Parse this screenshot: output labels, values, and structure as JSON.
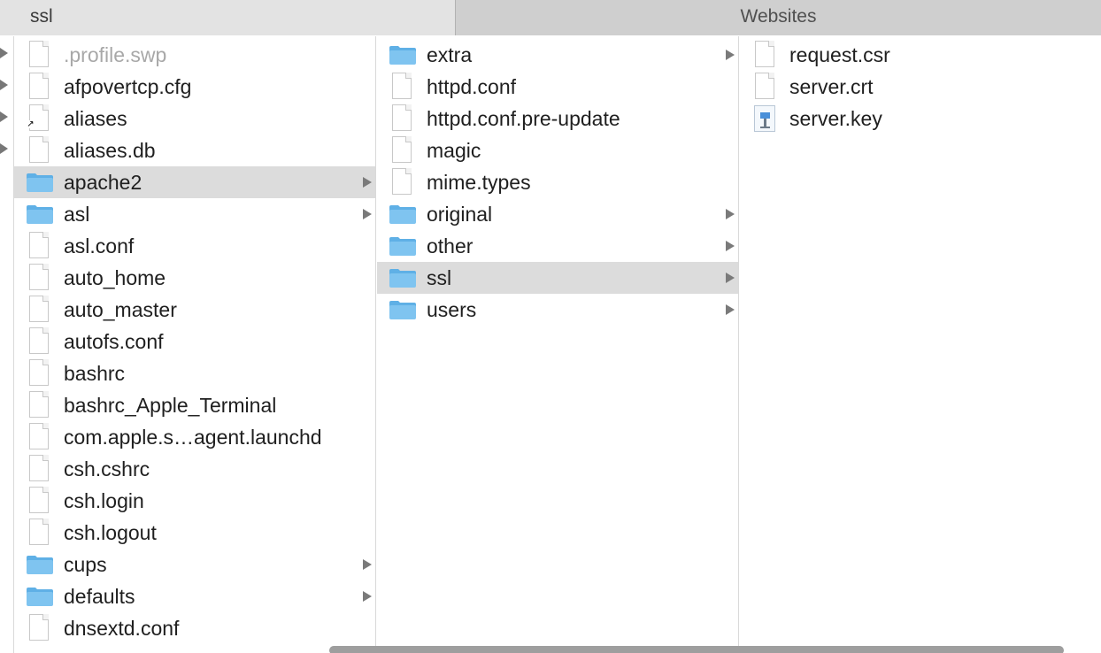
{
  "tabs": [
    {
      "label": "ssl",
      "active": true
    },
    {
      "label": "Websites",
      "active": false
    }
  ],
  "columns": [
    {
      "items": [
        {
          "name": ".profile.swp",
          "kind": "file",
          "dim": true
        },
        {
          "name": "afpovertcp.cfg",
          "kind": "file"
        },
        {
          "name": "aliases",
          "kind": "alias"
        },
        {
          "name": "aliases.db",
          "kind": "file"
        },
        {
          "name": "apache2",
          "kind": "folder",
          "selected": true
        },
        {
          "name": "asl",
          "kind": "folder"
        },
        {
          "name": "asl.conf",
          "kind": "file"
        },
        {
          "name": "auto_home",
          "kind": "file"
        },
        {
          "name": "auto_master",
          "kind": "file"
        },
        {
          "name": "autofs.conf",
          "kind": "file"
        },
        {
          "name": "bashrc",
          "kind": "file"
        },
        {
          "name": "bashrc_Apple_Terminal",
          "kind": "file"
        },
        {
          "name": "com.apple.s…agent.launchd",
          "kind": "file"
        },
        {
          "name": "csh.cshrc",
          "kind": "file"
        },
        {
          "name": "csh.login",
          "kind": "file"
        },
        {
          "name": "csh.logout",
          "kind": "file"
        },
        {
          "name": "cups",
          "kind": "folder"
        },
        {
          "name": "defaults",
          "kind": "folder"
        },
        {
          "name": "dnsextd.conf",
          "kind": "file"
        }
      ]
    },
    {
      "items": [
        {
          "name": "extra",
          "kind": "folder"
        },
        {
          "name": "httpd.conf",
          "kind": "file"
        },
        {
          "name": "httpd.conf.pre-update",
          "kind": "file"
        },
        {
          "name": "magic",
          "kind": "file"
        },
        {
          "name": "mime.types",
          "kind": "file"
        },
        {
          "name": "original",
          "kind": "folder"
        },
        {
          "name": "other",
          "kind": "folder"
        },
        {
          "name": "ssl",
          "kind": "folder",
          "selected": true
        },
        {
          "name": "users",
          "kind": "folder"
        }
      ]
    },
    {
      "items": [
        {
          "name": "request.csr",
          "kind": "file"
        },
        {
          "name": "server.crt",
          "kind": "file"
        },
        {
          "name": "server.key",
          "kind": "keynote"
        }
      ]
    }
  ],
  "colors": {
    "selection": "#dcdcdc",
    "folder_body": "#7fc4f0",
    "folder_tab": "#5fb0e6"
  }
}
